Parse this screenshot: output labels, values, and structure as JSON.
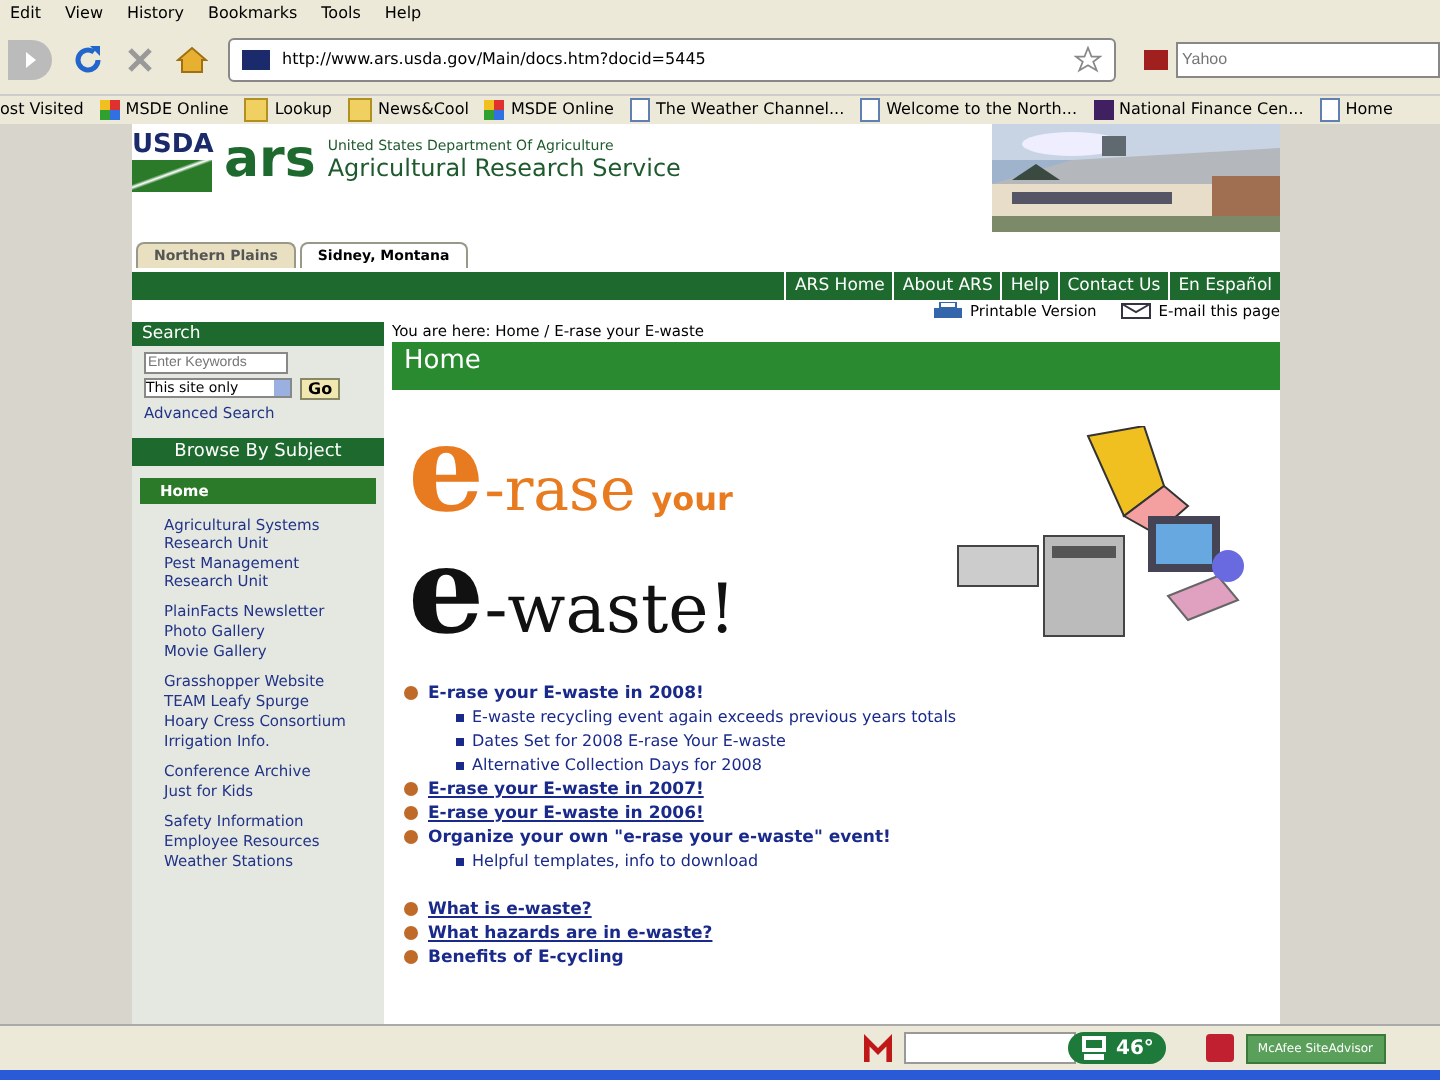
{
  "menu": [
    "Edit",
    "View",
    "History",
    "Bookmarks",
    "Tools",
    "Help"
  ],
  "address": {
    "value": "http://www.ars.usda.gov/Main/docs.htm?docid=5445"
  },
  "search_box": {
    "placeholder": "Yahoo"
  },
  "bookmarks": [
    {
      "label": "ost Visited",
      "kind": "none"
    },
    {
      "label": "MSDE Online",
      "kind": "site"
    },
    {
      "label": "Lookup",
      "kind": "folder"
    },
    {
      "label": "News&Cool",
      "kind": "folder"
    },
    {
      "label": "MSDE Online",
      "kind": "site"
    },
    {
      "label": "The Weather Channel...",
      "kind": "page"
    },
    {
      "label": "Welcome to the North...",
      "kind": "page"
    },
    {
      "label": "National Finance Cen...",
      "kind": "nfc"
    },
    {
      "label": "Home",
      "kind": "page"
    }
  ],
  "header": {
    "agency": "USDA",
    "logo": "ars",
    "department": "United States Department Of Agriculture",
    "service": "Agricultural Research Service"
  },
  "tabs": [
    {
      "label": "Northern Plains",
      "selected": false
    },
    {
      "label": "Sidney, Montana",
      "selected": true
    }
  ],
  "top_nav": [
    "ARS Home",
    "About ARS",
    "Help",
    "Contact Us",
    "En Español"
  ],
  "tools": [
    "Printable Version",
    "E-mail this page"
  ],
  "sidebar": {
    "search_title": "Search",
    "keyword_placeholder": "Enter Keywords",
    "scope": "This site only",
    "go": "Go",
    "advanced": "Advanced Search",
    "browse_title": "Browse By Subject",
    "groups": [
      [
        {
          "label": "Home",
          "selected": true
        }
      ],
      [
        {
          "label": "Agricultural Systems Research Unit",
          "selected": false
        },
        {
          "label": "Pest Management Research Unit",
          "selected": false
        }
      ],
      [
        {
          "label": "PlainFacts Newsletter",
          "selected": false
        },
        {
          "label": "Photo Gallery",
          "selected": false
        },
        {
          "label": "Movie Gallery",
          "selected": false
        }
      ],
      [
        {
          "label": "Grasshopper Website",
          "selected": false
        },
        {
          "label": "TEAM Leafy Spurge",
          "selected": false
        },
        {
          "label": "Hoary Cress Consortium",
          "selected": false
        },
        {
          "label": "Irrigation Info.",
          "selected": false
        }
      ],
      [
        {
          "label": "Conference Archive",
          "selected": false
        },
        {
          "label": "Just for Kids",
          "selected": false
        }
      ],
      [
        {
          "label": "Safety Information",
          "selected": false
        },
        {
          "label": "Employee Resources",
          "selected": false
        },
        {
          "label": "Weather Stations",
          "selected": false
        }
      ]
    ]
  },
  "breadcrumb": "You are here: Home / E-rase your E-waste",
  "page_title": "Home",
  "banner": {
    "e1": "e",
    "rase": "-rase",
    "your": "your",
    "e2": "e",
    "waste": "-waste!"
  },
  "links": [
    [
      {
        "label": "E-rase your E-waste in 2008!",
        "underlined": false,
        "children": [
          {
            "label": "E-waste recycling event again exceeds previous years totals"
          },
          {
            "label": "Dates Set for 2008 E-rase Your E-waste"
          },
          {
            "label": "Alternative Collection Days for 2008"
          }
        ]
      },
      {
        "label": "E-rase your E-waste in 2007!",
        "underlined": true
      },
      {
        "label": "E-rase your E-waste in 2006!",
        "underlined": true
      },
      {
        "label": "Organize your own \"e-rase your e-waste\" event!",
        "underlined": false,
        "children": [
          {
            "label": "Helpful templates, info to download"
          }
        ]
      }
    ],
    [
      {
        "label": "What is e-waste?",
        "underlined": true
      },
      {
        "label": "What hazards are in e-waste?",
        "underlined": true
      },
      {
        "label": "Benefits of E-cycling",
        "underlined": false
      }
    ]
  ],
  "status": {
    "weather": "46°",
    "advisor": "McAfee SiteAdvisor"
  }
}
